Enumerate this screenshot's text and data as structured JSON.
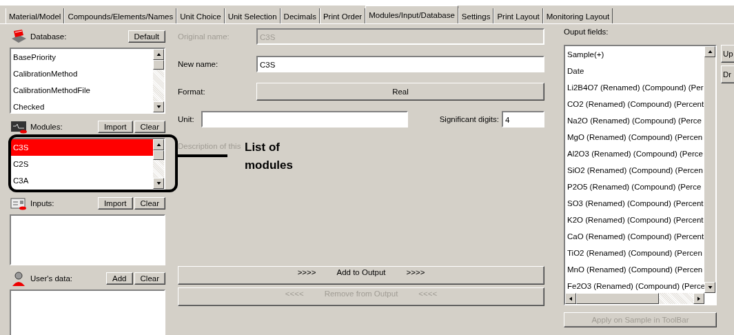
{
  "tabs": [
    {
      "label": "Material/Model",
      "selected": false
    },
    {
      "label": "Compounds/Elements/Names",
      "selected": false
    },
    {
      "label": "Unit Choice",
      "selected": false
    },
    {
      "label": "Unit Selection",
      "selected": false
    },
    {
      "label": "Decimals",
      "selected": false
    },
    {
      "label": "Print Order",
      "selected": false
    },
    {
      "label": "Modules/Input/Database",
      "selected": true
    },
    {
      "label": "Settings",
      "selected": false
    },
    {
      "label": "Print Layout",
      "selected": false
    },
    {
      "label": "Monitoring Layout",
      "selected": false
    }
  ],
  "left_panels": [
    {
      "kind": "database",
      "label": "Database:",
      "buttons": [
        "Default"
      ],
      "items": [
        {
          "text": "BasePriority",
          "selected": false
        },
        {
          "text": "CalibrationMethod",
          "selected": false
        },
        {
          "text": "CalibrationMethodFile",
          "selected": false
        },
        {
          "text": "Checked",
          "selected": false
        }
      ]
    },
    {
      "kind": "modules",
      "label": "Modules:",
      "buttons": [
        "Import",
        "Clear"
      ],
      "items": [
        {
          "text": "C3S",
          "selected": true
        },
        {
          "text": "C2S",
          "selected": false
        },
        {
          "text": "C3A",
          "selected": false
        }
      ]
    },
    {
      "kind": "inputs",
      "label": "Inputs:",
      "buttons": [
        "Import",
        "Clear"
      ]
    },
    {
      "kind": "users",
      "label": "User's data:",
      "buttons": [
        "Add",
        "Clear"
      ]
    }
  ],
  "details": {
    "original_name": {
      "label": "Original name:",
      "value": "C3S",
      "disabled": true
    },
    "new_name": {
      "label": "New name:",
      "value": "C3S",
      "disabled": false
    },
    "format": {
      "label": "Format:",
      "value": "Real"
    },
    "unit": {
      "label": "Unit:"
    },
    "significant_digits": {
      "label": "Significant digits:",
      "value": "4"
    },
    "description_label": "Description of this"
  },
  "actions": [
    {
      "left": ">>>>",
      "label": "Add to Output",
      "right": ">>>>",
      "disabled": false
    },
    {
      "left": "<<<<",
      "label": "Remove from Output",
      "right": "<<<<",
      "disabled": true
    }
  ],
  "output": {
    "label": "Ouput fields:",
    "items": [
      "Sample(+)",
      "Date",
      "Li2B4O7 (Renamed) (Compound) (Per",
      "CO2 (Renamed) (Compound) (Percent",
      "Na2O (Renamed) (Compound) (Perce",
      "MgO (Renamed) (Compound) (Percen",
      "Al2O3 (Renamed) (Compound) (Perce",
      "SiO2 (Renamed) (Compound) (Percen",
      "P2O5 (Renamed) (Compound) (Perce",
      "SO3 (Renamed) (Compound) (Percent",
      "K2O (Renamed) (Compound) (Percent",
      "CaO (Renamed) (Compound) (Percent",
      "TiO2 (Renamed) (Compound) (Percen",
      "MnO (Renamed) (Compound) (Percen",
      "Fe2O3 (Renamed) (Compound) (Perce"
    ],
    "side_buttons": [
      "Up",
      "Dr"
    ],
    "apply_button": {
      "label": "Apply on Sample in ToolBar",
      "disabled": true
    }
  },
  "annotation": {
    "text": "List of modules"
  }
}
